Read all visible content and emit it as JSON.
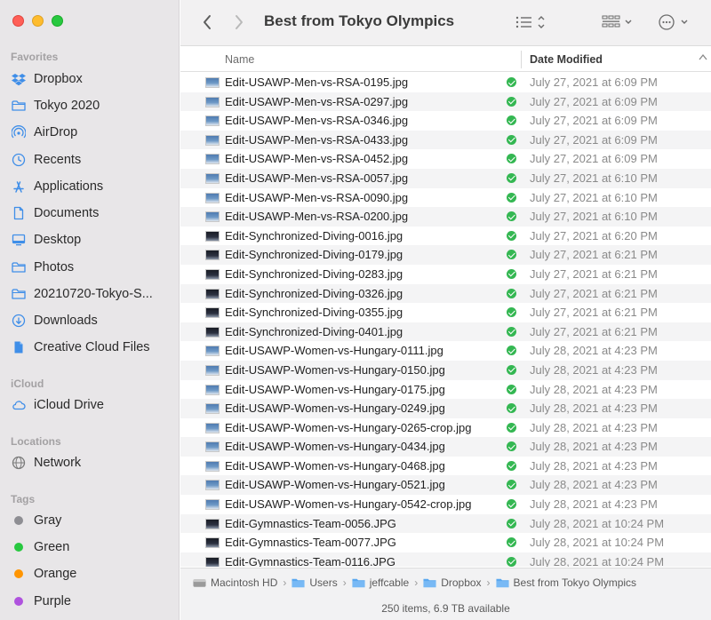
{
  "window": {
    "title": "Best from Tokyo Olympics"
  },
  "sidebar": {
    "favorites_title": "Favorites",
    "favorites": [
      {
        "label": "Dropbox",
        "icon": "dropbox-icon"
      },
      {
        "label": "Tokyo 2020",
        "icon": "folder-icon"
      },
      {
        "label": "AirDrop",
        "icon": "airdrop-icon"
      },
      {
        "label": "Recents",
        "icon": "clock-icon"
      },
      {
        "label": "Applications",
        "icon": "applications-icon"
      },
      {
        "label": "Documents",
        "icon": "document-icon"
      },
      {
        "label": "Desktop",
        "icon": "desktop-icon"
      },
      {
        "label": "Photos",
        "icon": "folder-icon"
      },
      {
        "label": "20210720-Tokyo-S...",
        "icon": "folder-icon"
      },
      {
        "label": "Downloads",
        "icon": "download-icon"
      },
      {
        "label": "Creative Cloud Files",
        "icon": "file-icon"
      }
    ],
    "icloud_title": "iCloud",
    "icloud": [
      {
        "label": "iCloud Drive",
        "icon": "cloud-icon"
      }
    ],
    "locations_title": "Locations",
    "locations": [
      {
        "label": "Network",
        "icon": "globe-icon"
      }
    ],
    "tags_title": "Tags",
    "tags": [
      {
        "label": "Gray",
        "color": "#8e8e93"
      },
      {
        "label": "Green",
        "color": "#28c840"
      },
      {
        "label": "Orange",
        "color": "#ff9500"
      },
      {
        "label": "Purple",
        "color": "#af52de"
      }
    ]
  },
  "columns": {
    "name": "Name",
    "date": "Date Modified"
  },
  "files": [
    {
      "name": "Edit-USAWP-Men-vs-RSA-0195.jpg",
      "date": "July 27, 2021 at 6:09 PM",
      "thumb": "pool"
    },
    {
      "name": "Edit-USAWP-Men-vs-RSA-0297.jpg",
      "date": "July 27, 2021 at 6:09 PM",
      "thumb": "pool"
    },
    {
      "name": "Edit-USAWP-Men-vs-RSA-0346.jpg",
      "date": "July 27, 2021 at 6:09 PM",
      "thumb": "pool"
    },
    {
      "name": "Edit-USAWP-Men-vs-RSA-0433.jpg",
      "date": "July 27, 2021 at 6:09 PM",
      "thumb": "pool"
    },
    {
      "name": "Edit-USAWP-Men-vs-RSA-0452.jpg",
      "date": "July 27, 2021 at 6:09 PM",
      "thumb": "pool"
    },
    {
      "name": "Edit-USAWP-Men-vs-RSA-0057.jpg",
      "date": "July 27, 2021 at 6:10 PM",
      "thumb": "pool"
    },
    {
      "name": "Edit-USAWP-Men-vs-RSA-0090.jpg",
      "date": "July 27, 2021 at 6:10 PM",
      "thumb": "pool"
    },
    {
      "name": "Edit-USAWP-Men-vs-RSA-0200.jpg",
      "date": "July 27, 2021 at 6:10 PM",
      "thumb": "pool"
    },
    {
      "name": "Edit-Synchronized-Diving-0016.jpg",
      "date": "July 27, 2021 at 6:20 PM",
      "thumb": "dark"
    },
    {
      "name": "Edit-Synchronized-Diving-0179.jpg",
      "date": "July 27, 2021 at 6:21 PM",
      "thumb": "dark"
    },
    {
      "name": "Edit-Synchronized-Diving-0283.jpg",
      "date": "July 27, 2021 at 6:21 PM",
      "thumb": "dark"
    },
    {
      "name": "Edit-Synchronized-Diving-0326.jpg",
      "date": "July 27, 2021 at 6:21 PM",
      "thumb": "dark"
    },
    {
      "name": "Edit-Synchronized-Diving-0355.jpg",
      "date": "July 27, 2021 at 6:21 PM",
      "thumb": "dark"
    },
    {
      "name": "Edit-Synchronized-Diving-0401.jpg",
      "date": "July 27, 2021 at 6:21 PM",
      "thumb": "dark"
    },
    {
      "name": "Edit-USAWP-Women-vs-Hungary-0111.jpg",
      "date": "July 28, 2021 at 4:23 PM",
      "thumb": "pool"
    },
    {
      "name": "Edit-USAWP-Women-vs-Hungary-0150.jpg",
      "date": "July 28, 2021 at 4:23 PM",
      "thumb": "pool"
    },
    {
      "name": "Edit-USAWP-Women-vs-Hungary-0175.jpg",
      "date": "July 28, 2021 at 4:23 PM",
      "thumb": "pool"
    },
    {
      "name": "Edit-USAWP-Women-vs-Hungary-0249.jpg",
      "date": "July 28, 2021 at 4:23 PM",
      "thumb": "pool"
    },
    {
      "name": "Edit-USAWP-Women-vs-Hungary-0265-crop.jpg",
      "date": "July 28, 2021 at 4:23 PM",
      "thumb": "pool"
    },
    {
      "name": "Edit-USAWP-Women-vs-Hungary-0434.jpg",
      "date": "July 28, 2021 at 4:23 PM",
      "thumb": "pool"
    },
    {
      "name": "Edit-USAWP-Women-vs-Hungary-0468.jpg",
      "date": "July 28, 2021 at 4:23 PM",
      "thumb": "pool"
    },
    {
      "name": "Edit-USAWP-Women-vs-Hungary-0521.jpg",
      "date": "July 28, 2021 at 4:23 PM",
      "thumb": "pool"
    },
    {
      "name": "Edit-USAWP-Women-vs-Hungary-0542-crop.jpg",
      "date": "July 28, 2021 at 4:23 PM",
      "thumb": "pool"
    },
    {
      "name": "Edit-Gymnastics-Team-0056.JPG",
      "date": "July 28, 2021 at 10:24 PM",
      "thumb": "dark"
    },
    {
      "name": "Edit-Gymnastics-Team-0077.JPG",
      "date": "July 28, 2021 at 10:24 PM",
      "thumb": "dark"
    },
    {
      "name": "Edit-Gymnastics-Team-0116.JPG",
      "date": "July 28, 2021 at 10:24 PM",
      "thumb": "dark"
    }
  ],
  "pathbar": [
    {
      "label": "Macintosh HD",
      "icon": "hard-drive-icon"
    },
    {
      "label": "Users",
      "icon": "folder-icon"
    },
    {
      "label": "jeffcable",
      "icon": "folder-icon"
    },
    {
      "label": "Dropbox",
      "icon": "folder-icon"
    },
    {
      "label": "Best from Tokyo Olympics",
      "icon": "folder-icon"
    }
  ],
  "status": {
    "text": "250 items, 6.9 TB available"
  },
  "colors": {
    "sync_ok": "#34b752",
    "folder_blue": "#3f8ee8"
  }
}
